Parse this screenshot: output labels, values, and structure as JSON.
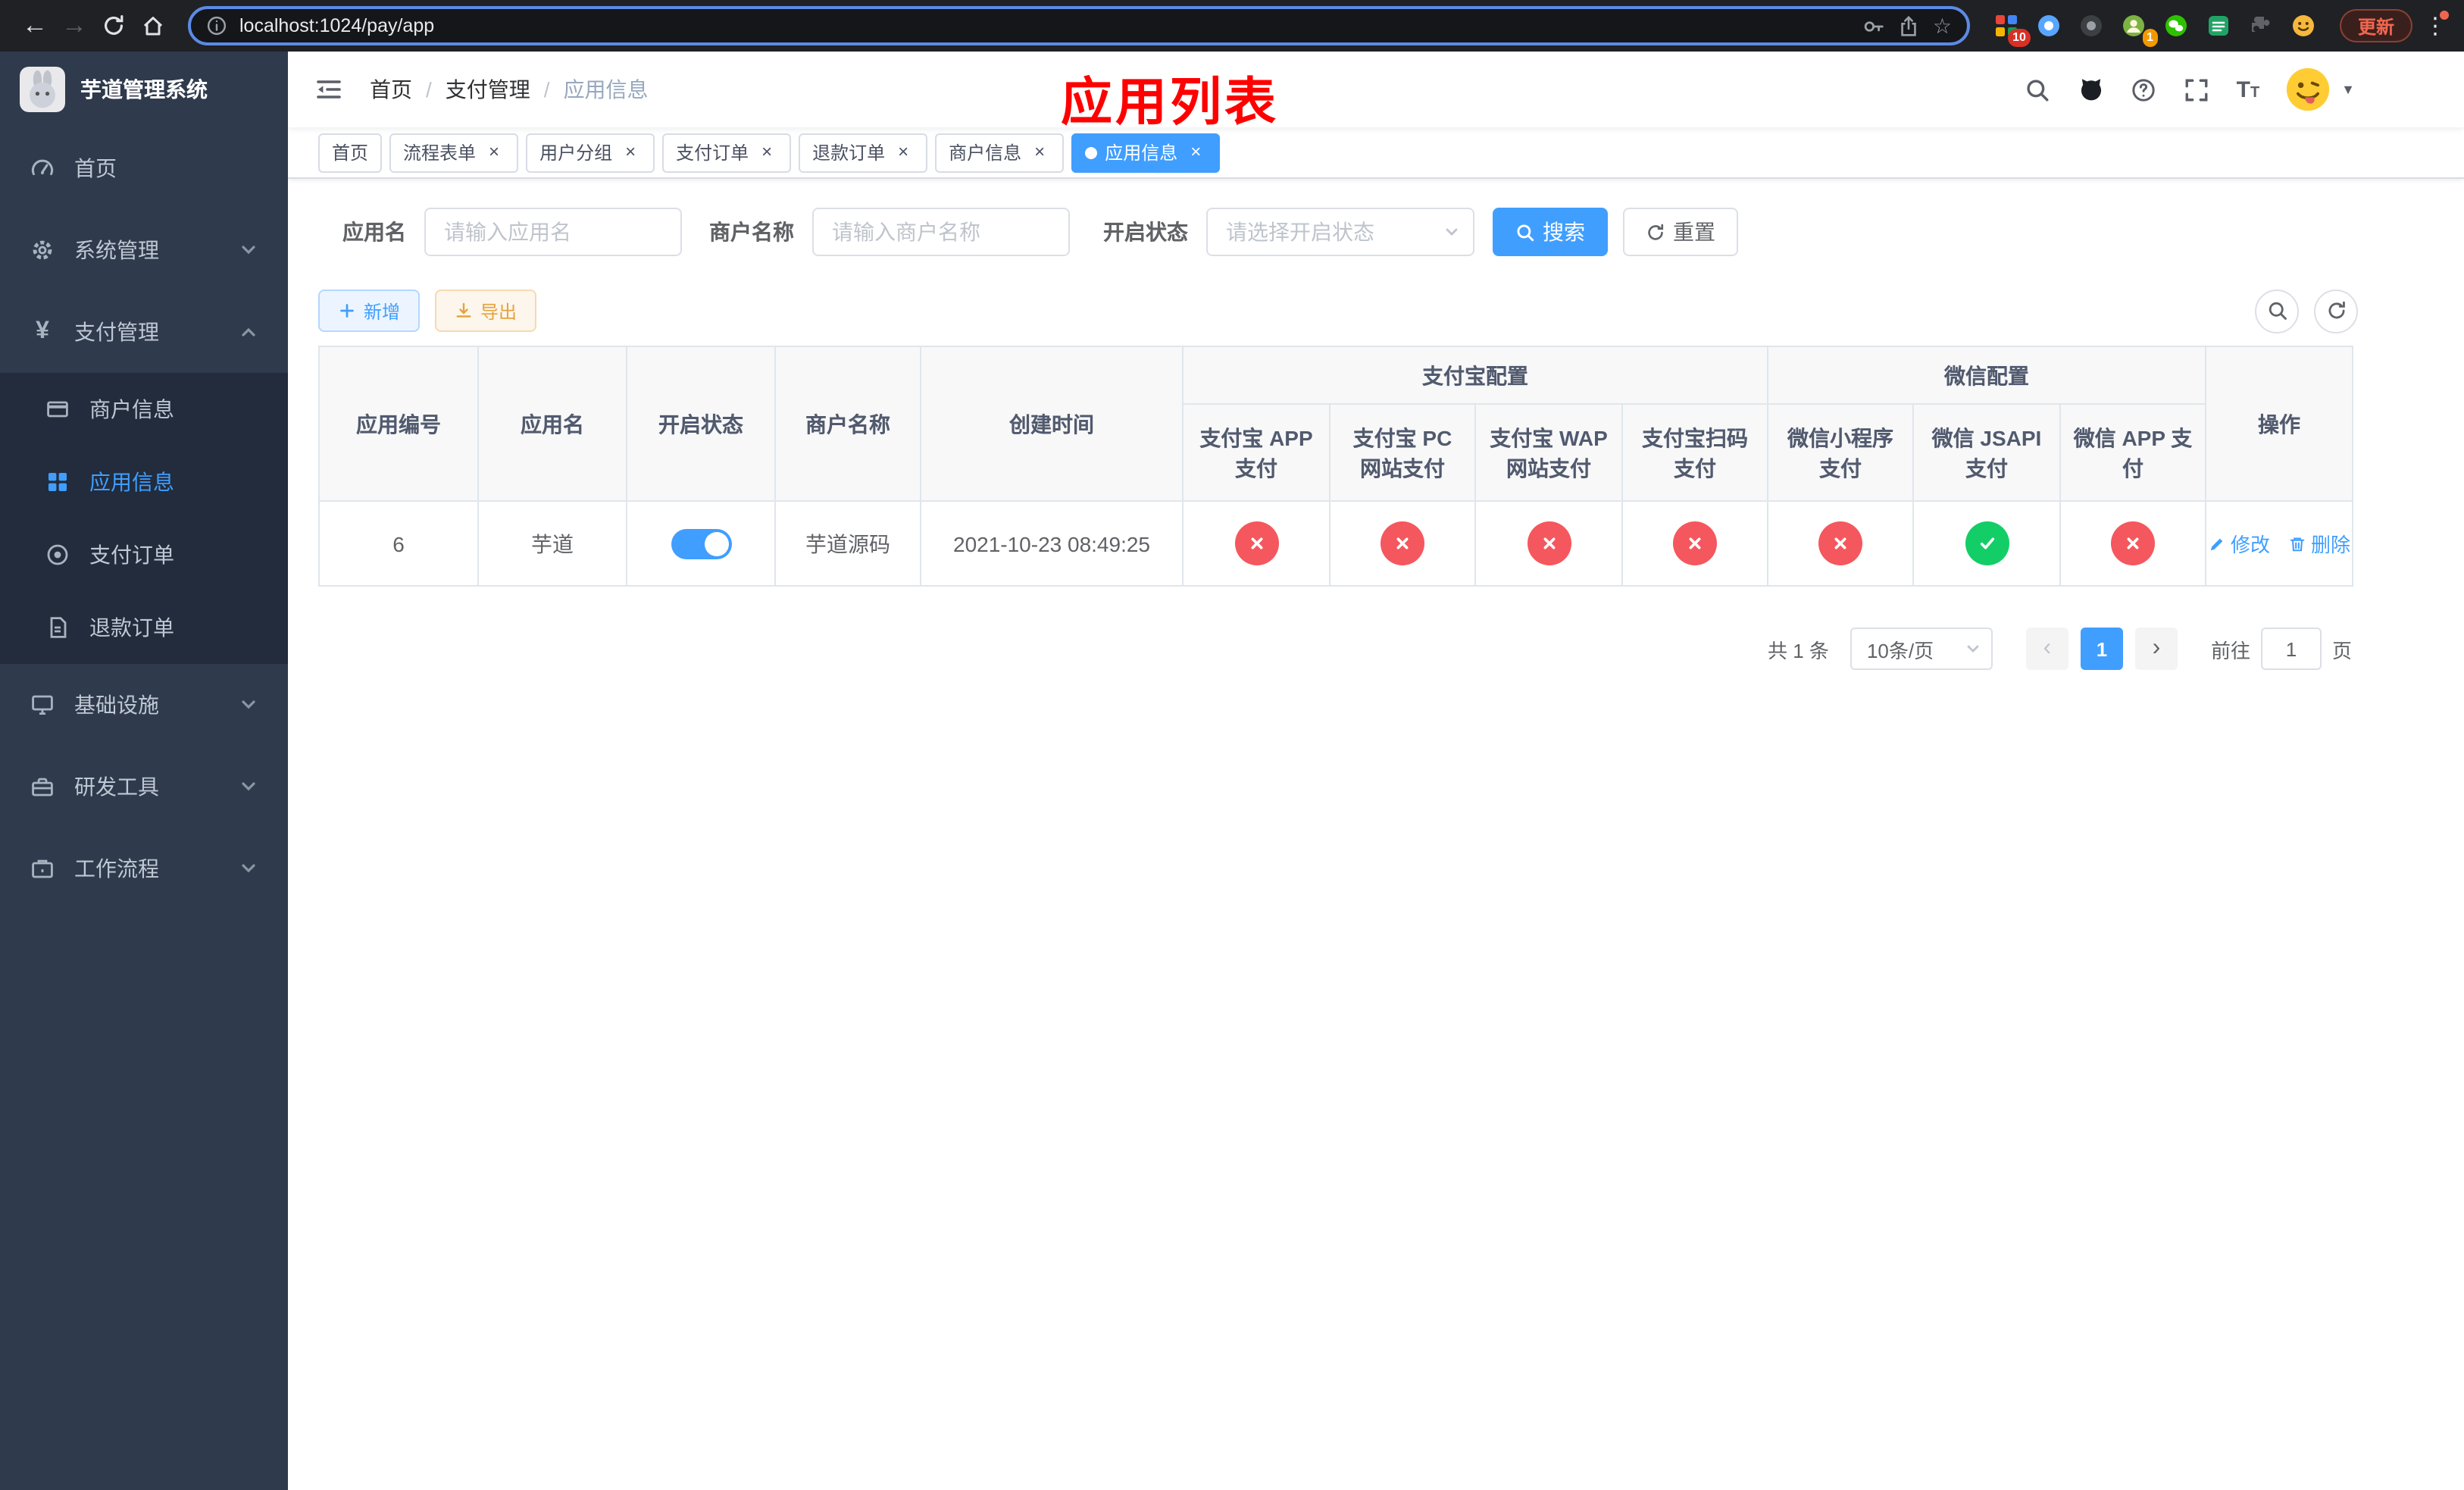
{
  "browser": {
    "url": "localhost:1024/pay/app",
    "update_label": "更新",
    "ext_badge_grid": "10",
    "ext_badge_avatar": "1"
  },
  "sidebar": {
    "logo_title": "芋道管理系统",
    "items": [
      {
        "label": "首页"
      },
      {
        "label": "系统管理"
      },
      {
        "label": "支付管理"
      },
      {
        "label": "基础设施"
      },
      {
        "label": "研发工具"
      },
      {
        "label": "工作流程"
      }
    ],
    "payment_submenu": [
      {
        "label": "商户信息"
      },
      {
        "label": "应用信息"
      },
      {
        "label": "支付订单"
      },
      {
        "label": "退款订单"
      }
    ]
  },
  "navbar": {
    "breadcrumb": [
      {
        "label": "首页"
      },
      {
        "label": "支付管理"
      },
      {
        "label": "应用信息"
      }
    ],
    "overlay_title": "应用列表"
  },
  "tags": [
    {
      "label": "首页"
    },
    {
      "label": "流程表单"
    },
    {
      "label": "用户分组"
    },
    {
      "label": "支付订单"
    },
    {
      "label": "退款订单"
    },
    {
      "label": "商户信息"
    },
    {
      "label": "应用信息"
    }
  ],
  "filters": {
    "app_name_label": "应用名",
    "app_name_placeholder": "请输入应用名",
    "merchant_label": "商户名称",
    "merchant_placeholder": "请输入商户名称",
    "status_label": "开启状态",
    "status_placeholder": "请选择开启状态",
    "search_label": "搜索",
    "reset_label": "重置"
  },
  "toolbar": {
    "add_label": "新增",
    "export_label": "导出"
  },
  "table": {
    "headers": {
      "app_id": "应用编号",
      "app_name": "应用名",
      "status": "开启状态",
      "merchant": "商户名称",
      "created": "创建时间",
      "alipay_group": "支付宝配置",
      "wechat_group": "微信配置",
      "alipay_app": "支付宝 APP 支付",
      "alipay_pc": "支付宝 PC 网站支付",
      "alipay_wap": "支付宝 WAP 网站支付",
      "alipay_qr": "支付宝扫码支付",
      "wechat_mini": "微信小程序支付",
      "wechat_jsapi": "微信 JSAPI 支付",
      "wechat_app": "微信 APP 支付",
      "actions": "操作"
    },
    "rows": [
      {
        "app_id": "6",
        "app_name": "芋道",
        "status_on": true,
        "merchant": "芋道源码",
        "created": "2021-10-23 08:49:25",
        "alipay_app": "disabled",
        "alipay_pc": "disabled",
        "alipay_wap": "disabled",
        "alipay_qr": "disabled",
        "wechat_mini": "disabled",
        "wechat_jsapi": "enabled",
        "wechat_app": "disabled",
        "edit_label": "修改",
        "delete_label": "删除"
      }
    ]
  },
  "pagination": {
    "total": "共 1 条",
    "page_size": "10条/页",
    "page": "1",
    "goto_label": "前往",
    "goto_value": "1",
    "unit_label": "页"
  },
  "colors": {
    "primary": "#409eff",
    "danger": "#f5575e",
    "success": "#13ce66",
    "annotation": "#ff0000"
  },
  "icons": {
    "back": "←",
    "forward": "→",
    "star": "☆",
    "kebab": "⋮",
    "close": "×",
    "caret_down": "▼",
    "yen": "¥",
    "font_big": "T",
    "font_small": "T",
    "prev": "‹",
    "next": "›"
  }
}
